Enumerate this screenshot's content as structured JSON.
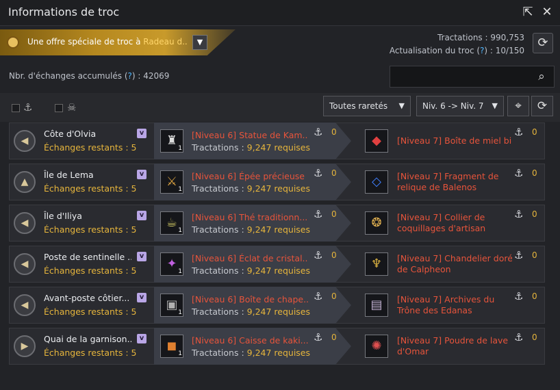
{
  "window": {
    "title": "Informations de troc"
  },
  "offer": {
    "prefix": "Une offre spéciale de troc à ",
    "destination": "Radeau d..."
  },
  "stats": {
    "tractations_label": "Tractations :",
    "tractations_value": "990,753",
    "actualisation_label": "Actualisation du troc (",
    "actualisation_q": "?",
    "actualisation_suffix": ") : 10/150"
  },
  "accumulated": {
    "label": "Nbr. d'échanges accumulés (",
    "q": "?",
    "suffix": ") : 42069"
  },
  "search": {
    "placeholder": ""
  },
  "filters": {
    "rarity": "Toutes raretés",
    "level": "Niv. 6 -> Niv. 7"
  },
  "rows": [
    {
      "location": "Côte d'Olvia",
      "remaining": "Échanges restants : 5",
      "dir_glyph": "◀",
      "give_name": "[Niveau 6] Statue de Kam...",
      "give_req_label": "Tractations : ",
      "give_req_value": "9,247 requises",
      "give_count": "0",
      "give_qty": "1",
      "give_icon": "statue-icon",
      "get_name": "[Niveau 7] Boîte de miel bio",
      "get_name2": "",
      "get_count": "0",
      "get_icon": "honey-box-icon"
    },
    {
      "location": "Île de Lema",
      "remaining": "Échanges restants : 5",
      "dir_glyph": "▲",
      "give_name": "[Niveau 6] Épée précieuse ...",
      "give_req_label": "Tractations : ",
      "give_req_value": "9,247 requises",
      "give_count": "0",
      "give_qty": "1",
      "give_icon": "sword-icon",
      "get_name": "[Niveau 7] Fragment de",
      "get_name2": "relique de Balenos",
      "get_count": "0",
      "get_icon": "relic-fragment-icon"
    },
    {
      "location": "Île d'Iliya",
      "remaining": "Échanges restants : 5",
      "dir_glyph": "◀",
      "give_name": "[Niveau 6] Thé traditionn...",
      "give_req_label": "Tractations : ",
      "give_req_value": "9,247 requises",
      "give_count": "0",
      "give_qty": "1",
      "give_icon": "tea-icon",
      "get_name": "[Niveau 7] Collier de",
      "get_name2": "coquillages d'artisan",
      "get_count": "0",
      "get_icon": "shell-necklace-icon"
    },
    {
      "location": "Poste de sentinelle ...",
      "remaining": "Échanges restants : 5",
      "dir_glyph": "◀",
      "give_name": "[Niveau 6] Éclat de cristal...",
      "give_req_label": "Tractations : ",
      "give_req_value": "9,247 requises",
      "give_count": "0",
      "give_qty": "1",
      "give_icon": "crystal-shard-icon",
      "get_name": "[Niveau 7] Chandelier doré",
      "get_name2": "de Calpheon",
      "get_count": "0",
      "get_icon": "chandelier-icon"
    },
    {
      "location": "Avant-poste côtier...",
      "remaining": "Échanges restants : 5",
      "dir_glyph": "◀",
      "give_name": "[Niveau 6] Boîte de chape...",
      "give_req_label": "Tractations : ",
      "give_req_value": "9,247 requises",
      "give_count": "0",
      "give_qty": "1",
      "give_icon": "hat-box-icon",
      "get_name": "[Niveau 7] Archives du",
      "get_name2": "Trône des Edanas",
      "get_count": "0",
      "get_icon": "archives-icon"
    },
    {
      "location": "Quai de la garnison...",
      "remaining": "Échanges restants : 5",
      "dir_glyph": "▶",
      "give_name": "[Niveau 6] Caisse de kaki...",
      "give_req_label": "Tractations : ",
      "give_req_value": "9,247 requises",
      "give_count": "0",
      "give_qty": "1",
      "give_icon": "persimmon-crate-icon",
      "get_name": "[Niveau 7] Poudre de lave",
      "get_name2": "d'Omar",
      "get_count": "0",
      "get_icon": "lava-powder-icon"
    }
  ]
}
